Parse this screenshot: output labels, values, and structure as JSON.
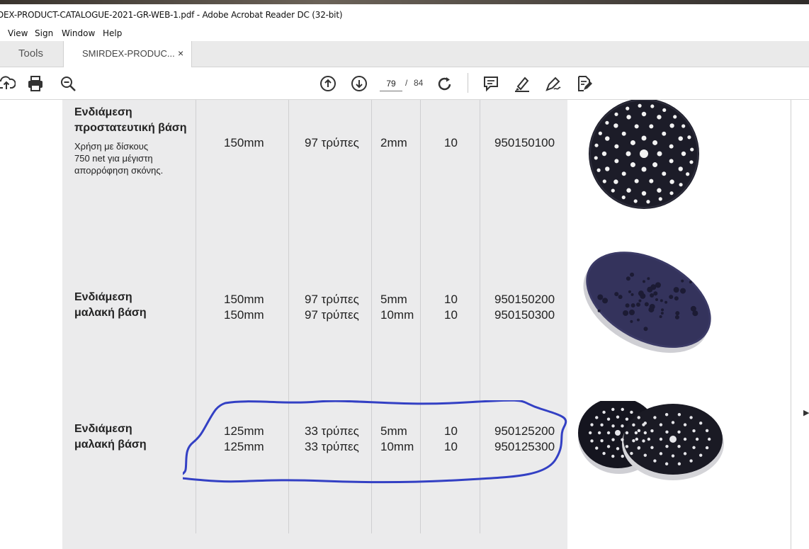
{
  "window": {
    "title": "DEX-PRODUCT-CATALOGUE-2021-GR-WEB-1.pdf - Adobe Acrobat Reader DC (32-bit)"
  },
  "menu": {
    "items": [
      "View",
      "Sign",
      "Window",
      "Help"
    ]
  },
  "tabs": {
    "tools": "Tools",
    "document": "SMIRDEX-PRODUC...",
    "close": "×"
  },
  "toolbar": {
    "current_page": "79",
    "separator": "/",
    "total_pages": "84",
    "icons": [
      "upload-icon",
      "print-icon",
      "zoom-icon",
      "page-up-icon",
      "page-down-icon",
      "rotate-icon",
      "comment-icon",
      "highlight-pen-icon",
      "sign-icon",
      "edit-pdf-icon"
    ]
  },
  "document": {
    "rows": [
      {
        "name_line1": "Ενδιάμεση",
        "name_line2": "προστατευτική βάση",
        "desc": [
          "Χρήση με δίσκους",
          "750 net για μέγιστη",
          "απορρόφηση σκόνης."
        ],
        "entries": [
          {
            "size": "150mm",
            "holes": "97 τρύπες",
            "thickness": "2mm",
            "qty": "10",
            "code": "950150100"
          }
        ]
      },
      {
        "name_line1": "Ενδιάμεση",
        "name_line2": "μαλακή βάση",
        "entries": [
          {
            "size": "150mm",
            "holes": "97 τρύπες",
            "thickness": "5mm",
            "qty": "10",
            "code": "950150200"
          },
          {
            "size": "150mm",
            "holes": "97 τρύπες",
            "thickness": "10mm",
            "qty": "10",
            "code": "950150300"
          }
        ]
      },
      {
        "name_line1": "Ενδιάμεση",
        "name_line2": "μαλακή βάση",
        "entries": [
          {
            "size": "125mm",
            "holes": "33 τρύπες",
            "thickness": "5mm",
            "qty": "10",
            "code": "950125200"
          },
          {
            "size": "125mm",
            "holes": "33 τρύπες",
            "thickness": "10mm",
            "qty": "10",
            "code": "950125300"
          }
        ]
      }
    ]
  },
  "colors": {
    "highlight_stroke": "#3340c4",
    "pad_dark": "#1e1e2c",
    "pad_purple": "#3d3a6a",
    "foam": "#d9d9de"
  }
}
